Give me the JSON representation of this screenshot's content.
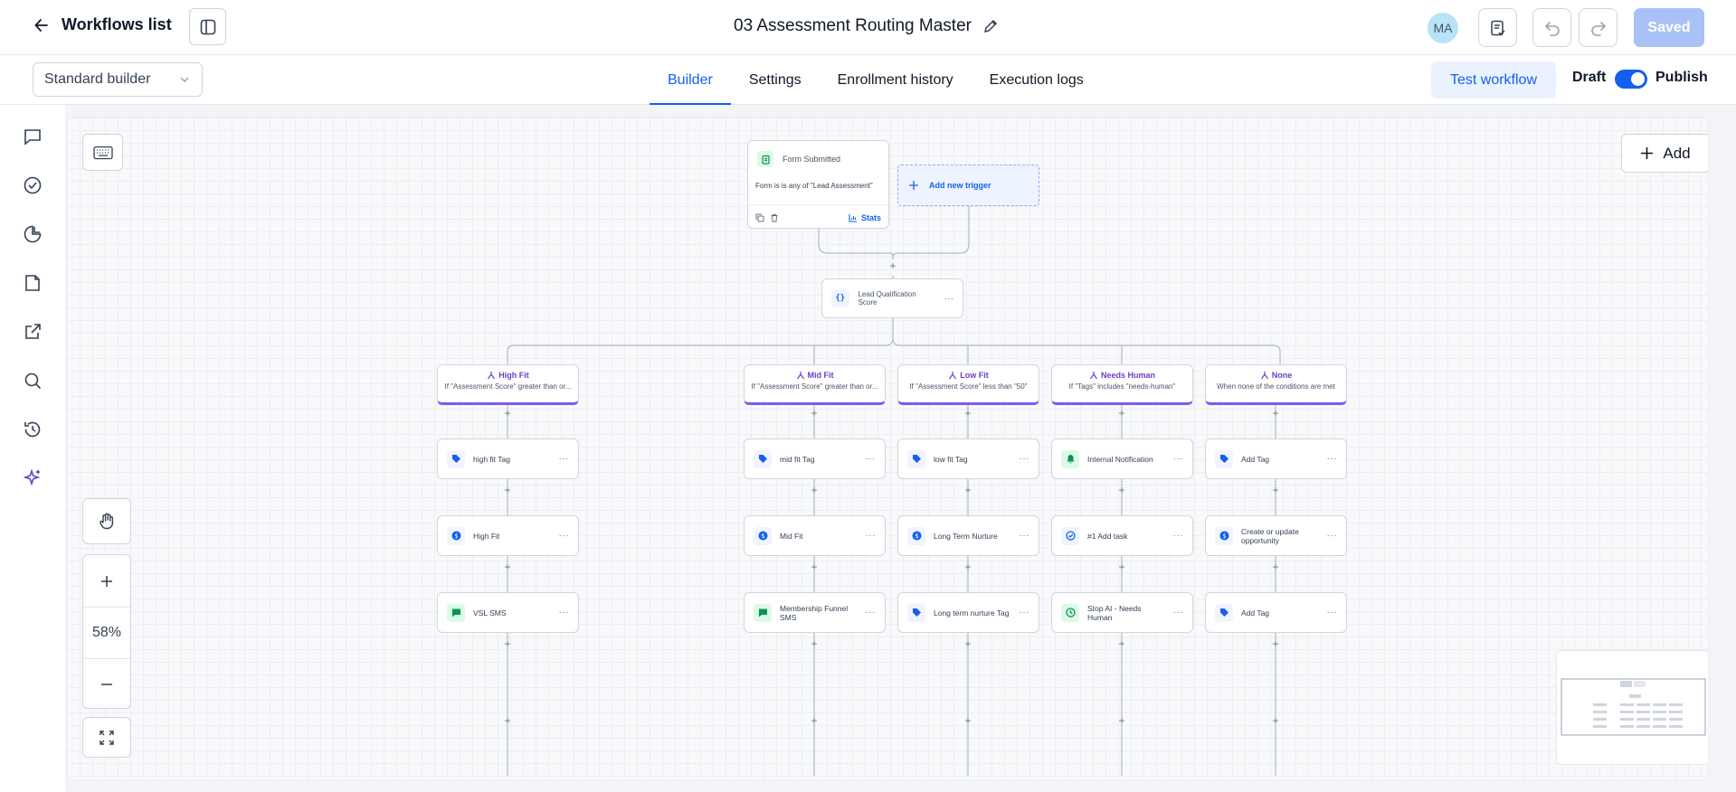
{
  "topbar": {
    "back_label": "Workflows list",
    "title": "03 Assessment Routing Master",
    "avatar_initials": "MA",
    "saved_label": "Saved"
  },
  "subbar": {
    "builder_mode": "Standard builder",
    "tabs": [
      {
        "label": "Builder",
        "active": true
      },
      {
        "label": "Settings",
        "active": false
      },
      {
        "label": "Enrollment history",
        "active": false
      },
      {
        "label": "Execution logs",
        "active": false
      }
    ],
    "test_label": "Test workflow",
    "draft_label": "Draft",
    "publish_label": "Publish"
  },
  "rail": [
    "chat-icon",
    "check-circle-icon",
    "pie-chart-icon",
    "document-icon",
    "external-link-icon",
    "search-icon",
    "history-icon",
    "sparkle-icon"
  ],
  "canvas": {
    "zoom_level": "58%",
    "add_label": "Add",
    "trigger": {
      "name": "Form Submitted",
      "condition": "Form is is any of \"Lead Assessment\"",
      "stats_label": "Stats"
    },
    "new_trigger_label": "Add new trigger",
    "code_node": "Lead Qualification Score",
    "branches": [
      {
        "name": "High Fit",
        "condition": "If \"Assessment Score\" greater than or..."
      },
      {
        "name": "Mid Fit",
        "condition": "If \"Assessment Score\" greater than or..."
      },
      {
        "name": "Low Fit",
        "condition": "If \"Assessment Score\" less than \"50\""
      },
      {
        "name": "Needs Human",
        "condition": "If \"Tags\" includes \"needs-human\""
      },
      {
        "name": "None",
        "condition": "When none of the conditions are met"
      }
    ],
    "actions": {
      "row1": [
        "high fit Tag",
        "mid fit Tag",
        "low fit Tag",
        "Internal Notification",
        "Add Tag"
      ],
      "row2": [
        "High Fit",
        "Mid Fit",
        "Long Term Nurture",
        "#1 Add task",
        "Create or update opportunity"
      ],
      "row3": [
        "VSL SMS",
        "Membership Funnel SMS",
        "Long term nurture Tag",
        "Stop AI - Needs Human",
        "Add Tag"
      ]
    }
  },
  "colors": {
    "accent": "#155eef",
    "branch": "#7a5af8",
    "saved_bg": "#a9c1f6"
  }
}
